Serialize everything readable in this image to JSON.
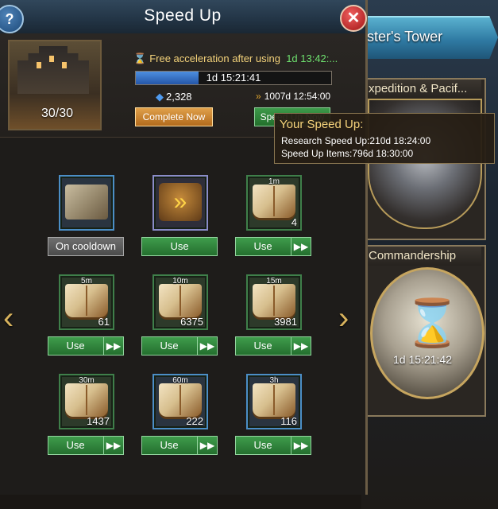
{
  "background": {
    "tower_label": "ster's Tower",
    "card1_title": "xpedition & Pacif...",
    "card2_title": "Commandership",
    "card2_timer": "1d 15:21:42"
  },
  "header": {
    "title": "Speed Up",
    "help_label": "?",
    "close_label": "✕"
  },
  "research": {
    "portrait_count": "30/30",
    "free_text": "Free acceleration after using",
    "free_time": "1d 13:42:...",
    "progress_label": "1d 15:21:41",
    "progress_fraction": 0.32,
    "gems": "2,328",
    "total_time": "1007d 12:54:00",
    "complete_label": "Complete Now",
    "speedup_label": "Speed Up Now"
  },
  "items": [
    {
      "duration": "",
      "count": "",
      "button": "On cooldown",
      "type": "scroll"
    },
    {
      "duration": "",
      "count": "",
      "button": "Use",
      "type": "auto"
    },
    {
      "duration": "1m",
      "count": "4",
      "button": "Use",
      "type": "book"
    },
    {
      "duration": "5m",
      "count": "61",
      "button": "Use",
      "type": "book"
    },
    {
      "duration": "10m",
      "count": "6375",
      "button": "Use",
      "type": "book"
    },
    {
      "duration": "15m",
      "count": "3981",
      "button": "Use",
      "type": "book"
    },
    {
      "duration": "30m",
      "count": "1437",
      "button": "Use",
      "type": "book"
    },
    {
      "duration": "60m",
      "count": "222",
      "button": "Use",
      "type": "book"
    },
    {
      "duration": "3h",
      "count": "116",
      "button": "Use",
      "type": "book"
    }
  ],
  "tooltip": {
    "title": "Your Speed Up:",
    "line1": "Research Speed Up:210d 18:24:00",
    "line2": "Speed Up Items:796d 18:30:00"
  },
  "nav": {
    "left_arrow": "‹",
    "right_arrow": "›"
  },
  "colors": {
    "accent_green": "#3f9c4c",
    "accent_orange": "#e0a04a",
    "free_time_green": "#6ee06e",
    "progress_blue": "#4d8fe0"
  }
}
